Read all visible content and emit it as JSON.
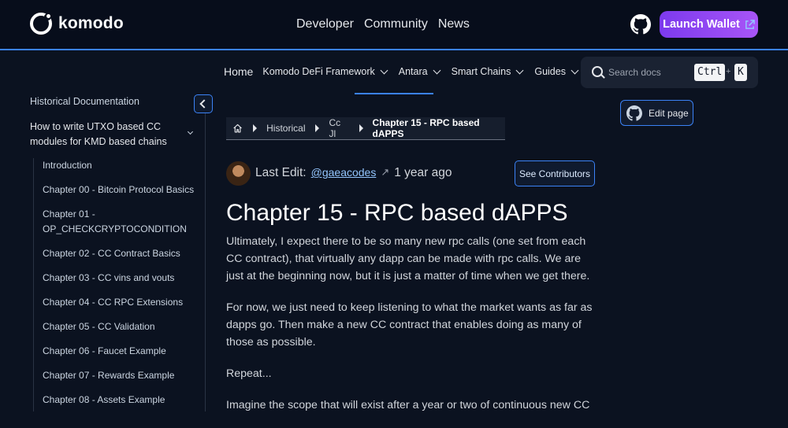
{
  "brand": {
    "name": "komodo"
  },
  "top_nav": [
    "Developer",
    "Community",
    "News"
  ],
  "launch_wallet": {
    "label": "Launch Wallet"
  },
  "secondary_nav": {
    "home": "Home",
    "items": [
      "Komodo DeFi Framework",
      "Antara",
      "Smart Chains",
      "Guides"
    ]
  },
  "search": {
    "placeholder": "Search docs",
    "key1": "Ctrl",
    "plus": "+",
    "key2": "K"
  },
  "sidebar": {
    "title": "Historical Documentation",
    "section": "How to write UTXO based CC modules for KMD based chains",
    "items": [
      "Introduction",
      "Chapter 00 - Bitcoin Protocol Basics",
      "Chapter 01 - OP_CHECKCRYPTOCONDITION",
      "Chapter 02 - CC Contract Basics",
      "Chapter 03 - CC vins and vouts",
      "Chapter 04 - CC RPC Extensions",
      "Chapter 05 - CC Validation",
      "Chapter 06 - Faucet Example",
      "Chapter 07 - Rewards Example",
      "Chapter 08 - Assets Example"
    ]
  },
  "edit_page": {
    "label": "Edit page"
  },
  "breadcrumb": [
    "Historical",
    "Cc Jl",
    "Chapter 15 - RPC based dAPPS"
  ],
  "last_edit": {
    "label": "Last Edit:",
    "user": "@gaeacodes",
    "arrow": "↗",
    "when": "1 year ago"
  },
  "contributors": {
    "label": "See Contributors"
  },
  "article": {
    "title": "Chapter 15 - RPC based dAPPS",
    "paragraphs": [
      "Ultimately, I expect there to be so many new rpc calls (one set from each CC contract), that virtually any dapp can be made with rpc calls. We are just at the beginning now, but it is just a matter of time when we get there.",
      "For now, we just need to keep listening to what the market wants as far as dapps go. Then make a new CC contract that enables doing as many of those as possible.",
      "Repeat...",
      "Imagine the scope that will exist after a year or two of continuous new CC"
    ]
  },
  "colors": {
    "accent": "#3b82f6",
    "launch_gradient": [
      "#7c3aed",
      "#a855f7"
    ],
    "background": "#0b1220"
  }
}
